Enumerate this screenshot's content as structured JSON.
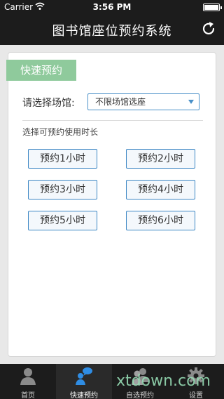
{
  "status_bar": {
    "carrier": "Carrier",
    "time": "3:56 PM"
  },
  "nav": {
    "title": "图书馆座位预约系统",
    "refresh_icon": "refresh-icon"
  },
  "quick_tag": "快速预约",
  "venue": {
    "label": "请选择场馆:",
    "selected": "不限场馆选座"
  },
  "duration_label": "选择可预约使用时长",
  "buttons": [
    "预约1小时",
    "预约2小时",
    "预约3小时",
    "预约4小时",
    "预约5小时",
    "预约6小时"
  ],
  "tabs": [
    {
      "label": "首页",
      "icon": "person-icon"
    },
    {
      "label": "快速预约",
      "icon": "chat-person-icon",
      "active": true
    },
    {
      "label": "自选预约",
      "icon": "people-icon"
    },
    {
      "label": "设置",
      "icon": "gear-icon"
    }
  ],
  "watermark": "xtdown.com",
  "colors": {
    "accent": "#3d87c4",
    "tag": "#8fca9c",
    "bar": "#1c1c1c"
  }
}
